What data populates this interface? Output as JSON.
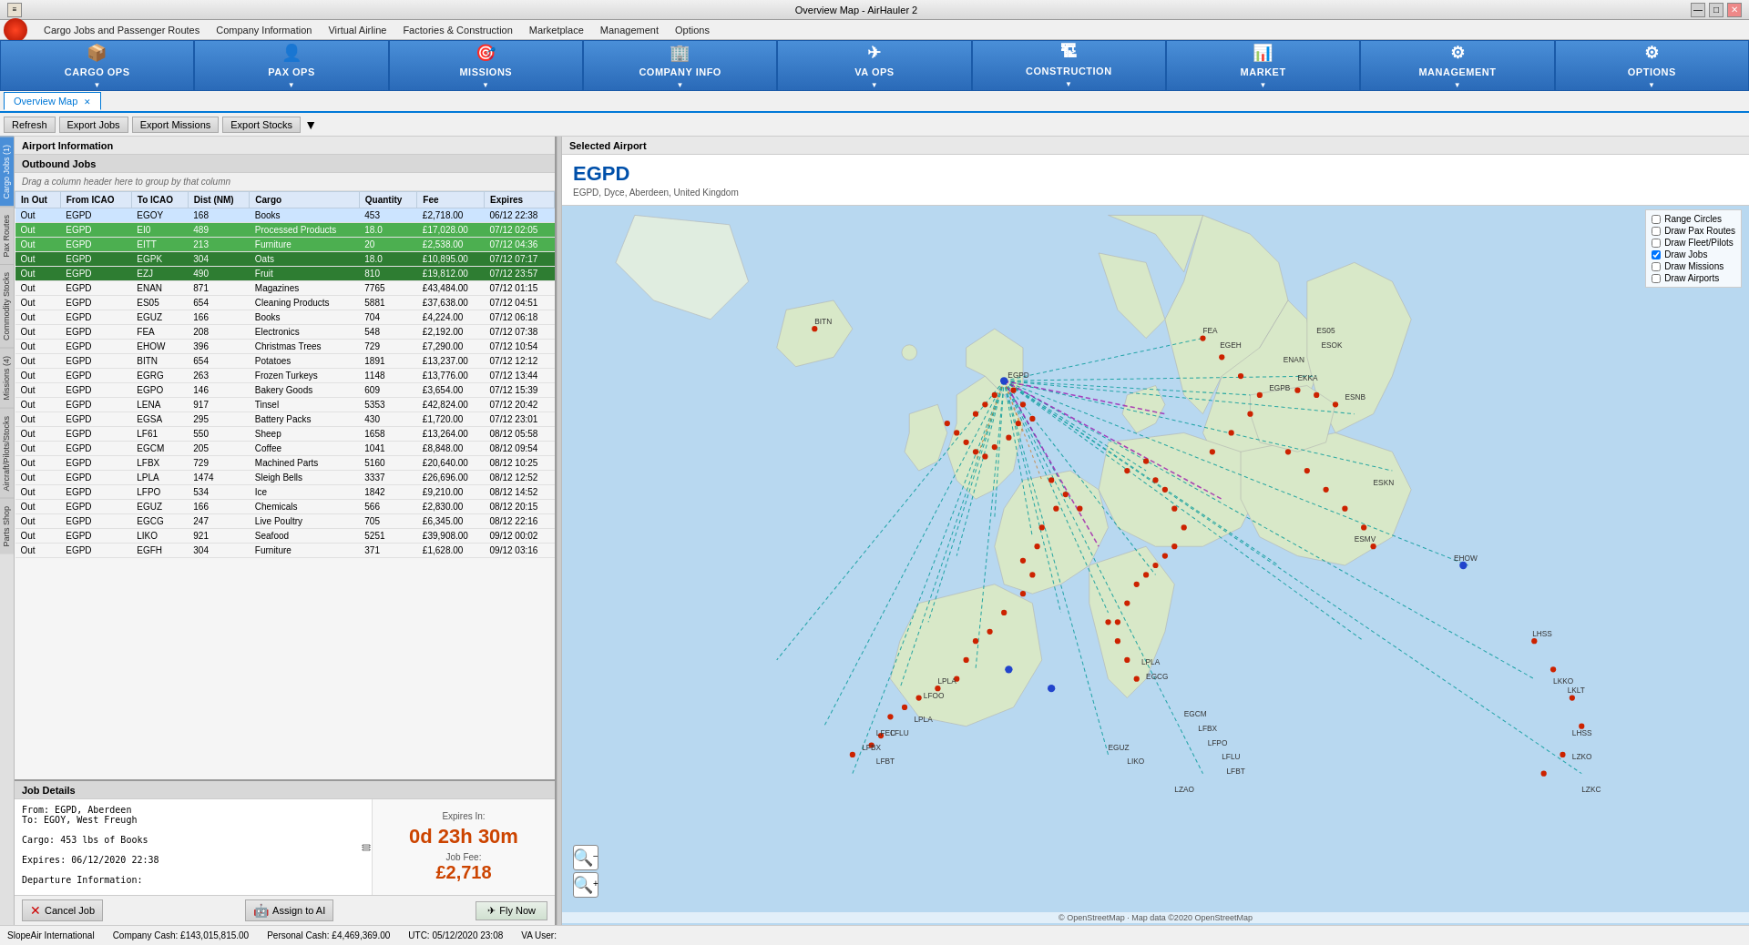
{
  "window": {
    "title": "Overview Map - AirHauler 2",
    "controls": [
      "—",
      "□",
      "✕"
    ]
  },
  "menubar": {
    "items": [
      "Cargo Jobs and Passenger Routes",
      "Company Information",
      "Virtual Airline",
      "Factories & Construction",
      "Marketplace",
      "Management",
      "Options"
    ]
  },
  "topnav": {
    "buttons": [
      {
        "label": "CARGO OPS",
        "icon": "📦"
      },
      {
        "label": "PAX OPS",
        "icon": "👤"
      },
      {
        "label": "MISSIONS",
        "icon": "🎯"
      },
      {
        "label": "COMPANY INFO",
        "icon": "🏢"
      },
      {
        "label": "VA OPS",
        "icon": "✈"
      },
      {
        "label": "CONSTRUCTION",
        "icon": "🏗"
      },
      {
        "label": "MARKET",
        "icon": "📊"
      },
      {
        "label": "MANAGEMENT",
        "icon": "⚙"
      },
      {
        "label": "OPTIONS",
        "icon": "⚙"
      }
    ]
  },
  "tabs": [
    {
      "label": "Overview Map",
      "active": true
    }
  ],
  "toolbar": {
    "buttons": [
      "Refresh",
      "Export Jobs",
      "Export Missions",
      "Export Stocks"
    ]
  },
  "sidetabs": [
    "Cargo Jobs (1)",
    "Pax Routes",
    "Commodity Stocks",
    "Missions (4)",
    "Aircraft/Pilots/Stocks",
    "Parts Shop"
  ],
  "airportInfo": {
    "header": "Airport Information",
    "outboundHeader": "Outbound Jobs",
    "dragHint": "Drag a column header here to group by that column"
  },
  "jobsTable": {
    "columns": [
      "In Out",
      "From ICAO",
      "To ICAO",
      "Dist (NM)",
      "Cargo",
      "Quantity",
      "Fee",
      "Expires"
    ],
    "rows": [
      {
        "inout": "Out",
        "from": "EGPD",
        "to": "EGOY",
        "dist": "168",
        "cargo": "Books",
        "qty": "453",
        "fee": "£2,718.00",
        "expires": "06/12 22:38",
        "style": "selected"
      },
      {
        "inout": "Out",
        "from": "EGPD",
        "to": "EI0",
        "dist": "489",
        "cargo": "Processed Products",
        "qty": "18.0",
        "fee": "£17,028.00",
        "expires": "07/12 02:05",
        "style": "green"
      },
      {
        "inout": "Out",
        "from": "EGPD",
        "to": "EITT",
        "dist": "213",
        "cargo": "Furniture",
        "qty": "20",
        "fee": "£2,538.00",
        "expires": "07/12 04:36",
        "style": "green"
      },
      {
        "inout": "Out",
        "from": "EGPD",
        "to": "EGPK",
        "dist": "304",
        "cargo": "Oats",
        "qty": "18.0",
        "fee": "£10,895.00",
        "expires": "07/12 07:17",
        "style": "dkgreen"
      },
      {
        "inout": "Out",
        "from": "EGPD",
        "to": "EZJ",
        "dist": "490",
        "cargo": "Fruit",
        "qty": "810",
        "fee": "£19,812.00",
        "expires": "07/12 23:57",
        "style": "dkgreen"
      },
      {
        "inout": "Out",
        "from": "EGPD",
        "to": "ENAN",
        "dist": "871",
        "cargo": "Magazines",
        "qty": "7765",
        "fee": "£43,484.00",
        "expires": "07/12 01:15",
        "style": ""
      },
      {
        "inout": "Out",
        "from": "EGPD",
        "to": "ES05",
        "dist": "654",
        "cargo": "Cleaning Products",
        "qty": "5881",
        "fee": "£37,638.00",
        "expires": "07/12 04:51",
        "style": ""
      },
      {
        "inout": "Out",
        "from": "EGPD",
        "to": "EGUZ",
        "dist": "166",
        "cargo": "Books",
        "qty": "704",
        "fee": "£4,224.00",
        "expires": "07/12 06:18",
        "style": ""
      },
      {
        "inout": "Out",
        "from": "EGPD",
        "to": "FEA",
        "dist": "208",
        "cargo": "Electronics",
        "qty": "548",
        "fee": "£2,192.00",
        "expires": "07/12 07:38",
        "style": ""
      },
      {
        "inout": "Out",
        "from": "EGPD",
        "to": "EHOW",
        "dist": "396",
        "cargo": "Christmas Trees",
        "qty": "729",
        "fee": "£7,290.00",
        "expires": "07/12 10:54",
        "style": ""
      },
      {
        "inout": "Out",
        "from": "EGPD",
        "to": "BITN",
        "dist": "654",
        "cargo": "Potatoes",
        "qty": "1891",
        "fee": "£13,237.00",
        "expires": "07/12 12:12",
        "style": ""
      },
      {
        "inout": "Out",
        "from": "EGPD",
        "to": "EGRG",
        "dist": "263",
        "cargo": "Frozen Turkeys",
        "qty": "1148",
        "fee": "£13,776.00",
        "expires": "07/12 13:44",
        "style": ""
      },
      {
        "inout": "Out",
        "from": "EGPD",
        "to": "EGPO",
        "dist": "146",
        "cargo": "Bakery Goods",
        "qty": "609",
        "fee": "£3,654.00",
        "expires": "07/12 15:39",
        "style": ""
      },
      {
        "inout": "Out",
        "from": "EGPD",
        "to": "LENA",
        "dist": "917",
        "cargo": "Tinsel",
        "qty": "5353",
        "fee": "£42,824.00",
        "expires": "07/12 20:42",
        "style": ""
      },
      {
        "inout": "Out",
        "from": "EGPD",
        "to": "EGSA",
        "dist": "295",
        "cargo": "Battery Packs",
        "qty": "430",
        "fee": "£1,720.00",
        "expires": "07/12 23:01",
        "style": ""
      },
      {
        "inout": "Out",
        "from": "EGPD",
        "to": "LF61",
        "dist": "550",
        "cargo": "Sheep",
        "qty": "1658",
        "fee": "£13,264.00",
        "expires": "08/12 05:58",
        "style": ""
      },
      {
        "inout": "Out",
        "from": "EGPD",
        "to": "EGCM",
        "dist": "205",
        "cargo": "Coffee",
        "qty": "1041",
        "fee": "£8,848.00",
        "expires": "08/12 09:54",
        "style": ""
      },
      {
        "inout": "Out",
        "from": "EGPD",
        "to": "LFBX",
        "dist": "729",
        "cargo": "Machined Parts",
        "qty": "5160",
        "fee": "£20,640.00",
        "expires": "08/12 10:25",
        "style": ""
      },
      {
        "inout": "Out",
        "from": "EGPD",
        "to": "LPLA",
        "dist": "1474",
        "cargo": "Sleigh Bells",
        "qty": "3337",
        "fee": "£26,696.00",
        "expires": "08/12 12:52",
        "style": ""
      },
      {
        "inout": "Out",
        "from": "EGPD",
        "to": "LFPO",
        "dist": "534",
        "cargo": "Ice",
        "qty": "1842",
        "fee": "£9,210.00",
        "expires": "08/12 14:52",
        "style": ""
      },
      {
        "inout": "Out",
        "from": "EGPD",
        "to": "EGUZ",
        "dist": "166",
        "cargo": "Chemicals",
        "qty": "566",
        "fee": "£2,830.00",
        "expires": "08/12 20:15",
        "style": ""
      },
      {
        "inout": "Out",
        "from": "EGPD",
        "to": "EGCG",
        "dist": "247",
        "cargo": "Live Poultry",
        "qty": "705",
        "fee": "£6,345.00",
        "expires": "08/12 22:16",
        "style": ""
      },
      {
        "inout": "Out",
        "from": "EGPD",
        "to": "LIKO",
        "dist": "921",
        "cargo": "Seafood",
        "qty": "5251",
        "fee": "£39,908.00",
        "expires": "09/12 00:02",
        "style": ""
      },
      {
        "inout": "Out",
        "from": "EGPD",
        "to": "EGFH",
        "dist": "304",
        "cargo": "Furniture",
        "qty": "371",
        "fee": "£1,628.00",
        "expires": "09/12 03:16",
        "style": ""
      }
    ]
  },
  "jobDetails": {
    "header": "Job Details",
    "text": "From: EGPD, Aberdeen\nTo: EGOY, West Freugh\n\nCargo: 453 lbs of Books\n\nExpires: 06/12/2020 22:38\n\nDeparture Information:",
    "expiresLabel": "Expires In:",
    "expiresValue": "0d 23h 30m",
    "feeLabel": "Job Fee:",
    "feeValue": "£2,718",
    "cancelLabel": "Cancel Job",
    "assignLabel": "Assign to AI",
    "flyLabel": "Fly Now"
  },
  "selectedAirport": {
    "header": "Selected Airport",
    "code": "EGPD",
    "name": "EGPD, Dyce, Aberdeen, United Kingdom"
  },
  "mapOptions": {
    "rangeCircles": {
      "label": "Range Circles",
      "checked": false
    },
    "drawPaxRoutes": {
      "label": "Draw Pax Routes",
      "checked": false
    },
    "drawFleetPilots": {
      "label": "Draw Fleet/Pilots",
      "checked": false
    },
    "drawJobs": {
      "label": "Draw Jobs",
      "checked": true
    },
    "drawMissions": {
      "label": "Draw Missions",
      "checked": false
    },
    "drawAirports": {
      "label": "Draw Airports",
      "checked": false
    }
  },
  "statusBar": {
    "airline": "SlopeAir International",
    "companyCash": "Company Cash: £143,015,815.00",
    "personalCash": "Personal Cash: £4,469,369.00",
    "utc": "UTC: 05/12/2020 23:08",
    "va": "VA User:"
  }
}
